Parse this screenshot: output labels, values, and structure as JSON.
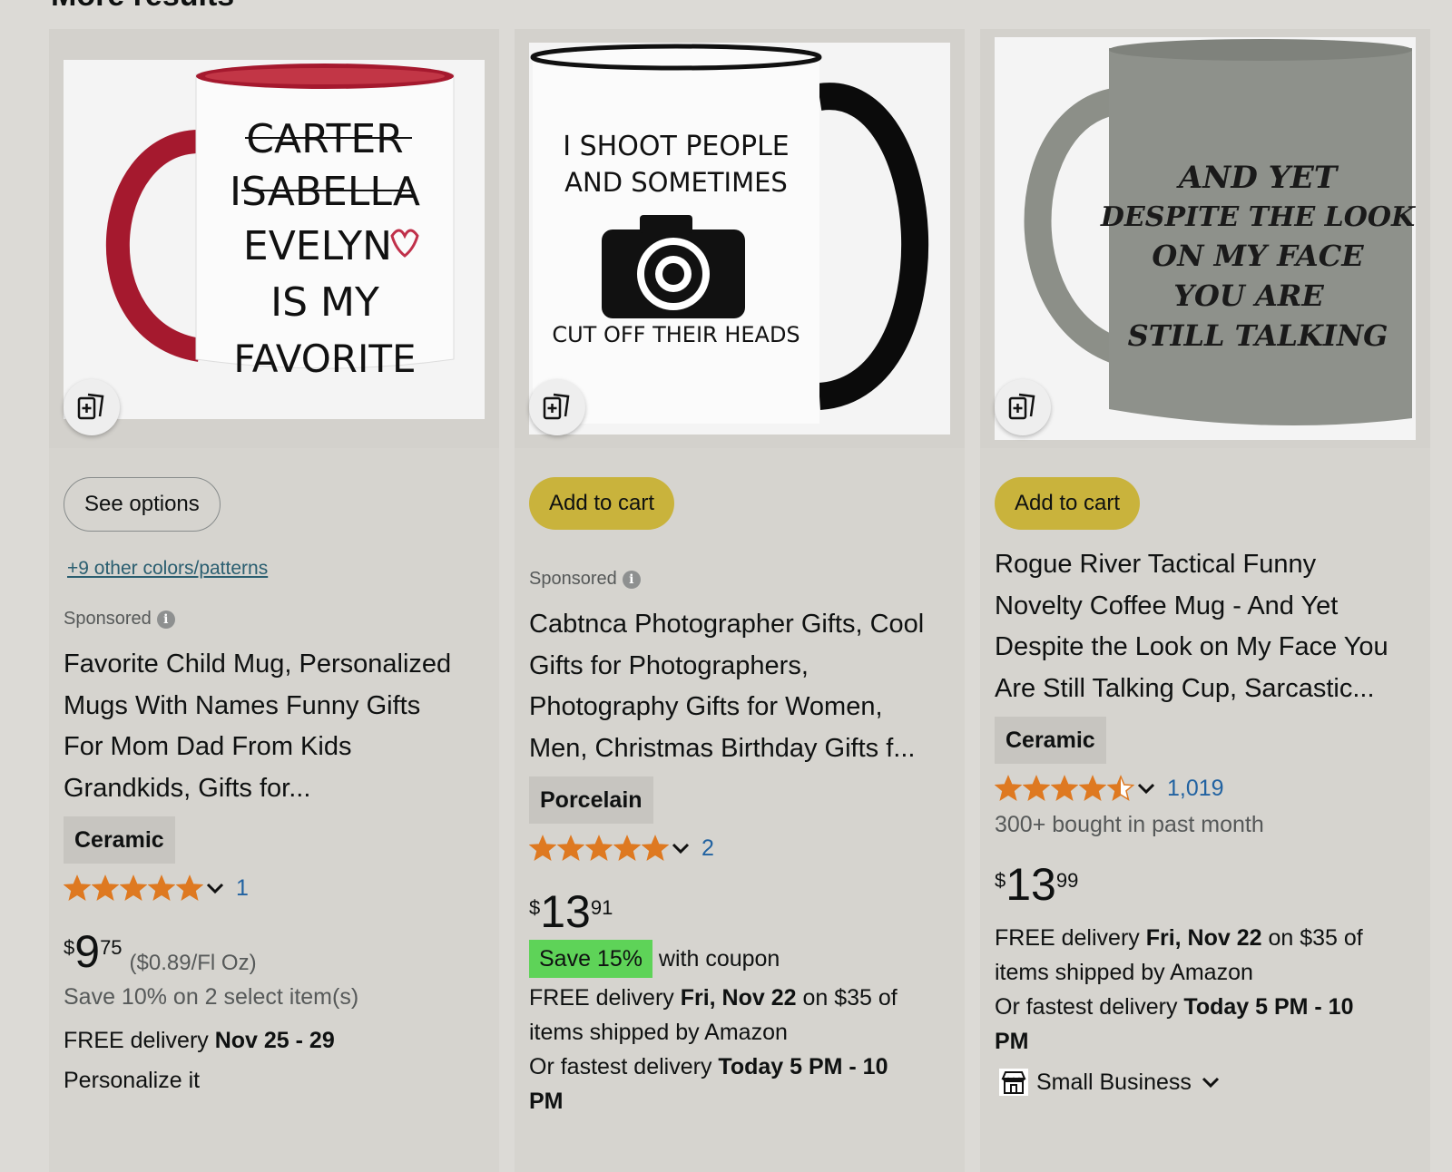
{
  "section": {
    "title": "More results"
  },
  "icons": {
    "compare": "add-to-compare-icon",
    "info": "info-icon",
    "star": "star-icon",
    "chevron": "chevron-down-icon",
    "store": "storefront-icon"
  },
  "colors": {
    "star": "#de7921",
    "cart_button": "#c9b33c",
    "link": "#2162a1",
    "save_badge": "#5ed358"
  },
  "products": [
    {
      "image_text": [
        "CARTER",
        "ISABELLA",
        "EVELYN",
        "IS MY",
        "FAVORITE"
      ],
      "button": "See options",
      "colors_link": "+9 other colors/patterns",
      "sponsored": "Sponsored",
      "title_lines": [
        "Favorite Child Mug, Personalized",
        "Mugs With Names Funny Gifts",
        "For Mom Dad From Kids",
        "Grandkids, Gifts for..."
      ],
      "material": "Ceramic",
      "rating": 5.0,
      "rating_count": "1",
      "price_symbol": "$",
      "price_whole": "9",
      "price_fraction": "75",
      "unit_price": "($0.89/Fl Oz)",
      "save_text": "Save 10% on 2 select item(s)",
      "delivery_prefix": "FREE delivery ",
      "delivery_date": "Nov 25 - 29",
      "extra": "Personalize it"
    },
    {
      "image_text": [
        "I SHOOT PEOPLE",
        "AND SOMETIMES",
        "CUT OFF THEIR HEADS"
      ],
      "button": "Add to cart",
      "sponsored": "Sponsored",
      "title_lines": [
        "Cabtnca Photographer Gifts, Cool",
        "Gifts for Photographers,",
        "Photography Gifts for Women,",
        "Men, Christmas Birthday Gifts f..."
      ],
      "material": "Porcelain",
      "rating": 5.0,
      "rating_count": "2",
      "price_symbol": "$",
      "price_whole": "13",
      "price_fraction": "91",
      "coupon_badge": "Save 15%",
      "coupon_suffix": " with coupon",
      "delivery_prefix": "FREE delivery ",
      "delivery_date": "Fri, Nov 22",
      "delivery_suffix": " on $35 of",
      "delivery_line2": "items shipped by Amazon",
      "fastest_prefix": "Or fastest delivery ",
      "fastest_time": "Today 5 PM - 10",
      "fastest_time2": "PM"
    },
    {
      "image_text": [
        "AND YET",
        "DESPITE THE LOOK",
        "ON MY FACE",
        "YOU ARE",
        "STILL TALKING"
      ],
      "button": "Add to cart",
      "title_lines": [
        "Rogue River Tactical Funny",
        "Novelty Coffee Mug - And Yet",
        "Despite the Look on My Face You",
        "Are Still Talking Cup, Sarcastic..."
      ],
      "material": "Ceramic",
      "rating": 4.5,
      "rating_count": "1,019",
      "bought": "300+ bought in past month",
      "price_symbol": "$",
      "price_whole": "13",
      "price_fraction": "99",
      "delivery_prefix": "FREE delivery ",
      "delivery_date": "Fri, Nov 22",
      "delivery_suffix": " on $35 of",
      "delivery_line2": "items shipped by Amazon",
      "fastest_prefix": "Or fastest delivery ",
      "fastest_time": "Today 5 PM - 10",
      "fastest_time2": "PM",
      "small_business": "Small Business"
    }
  ]
}
